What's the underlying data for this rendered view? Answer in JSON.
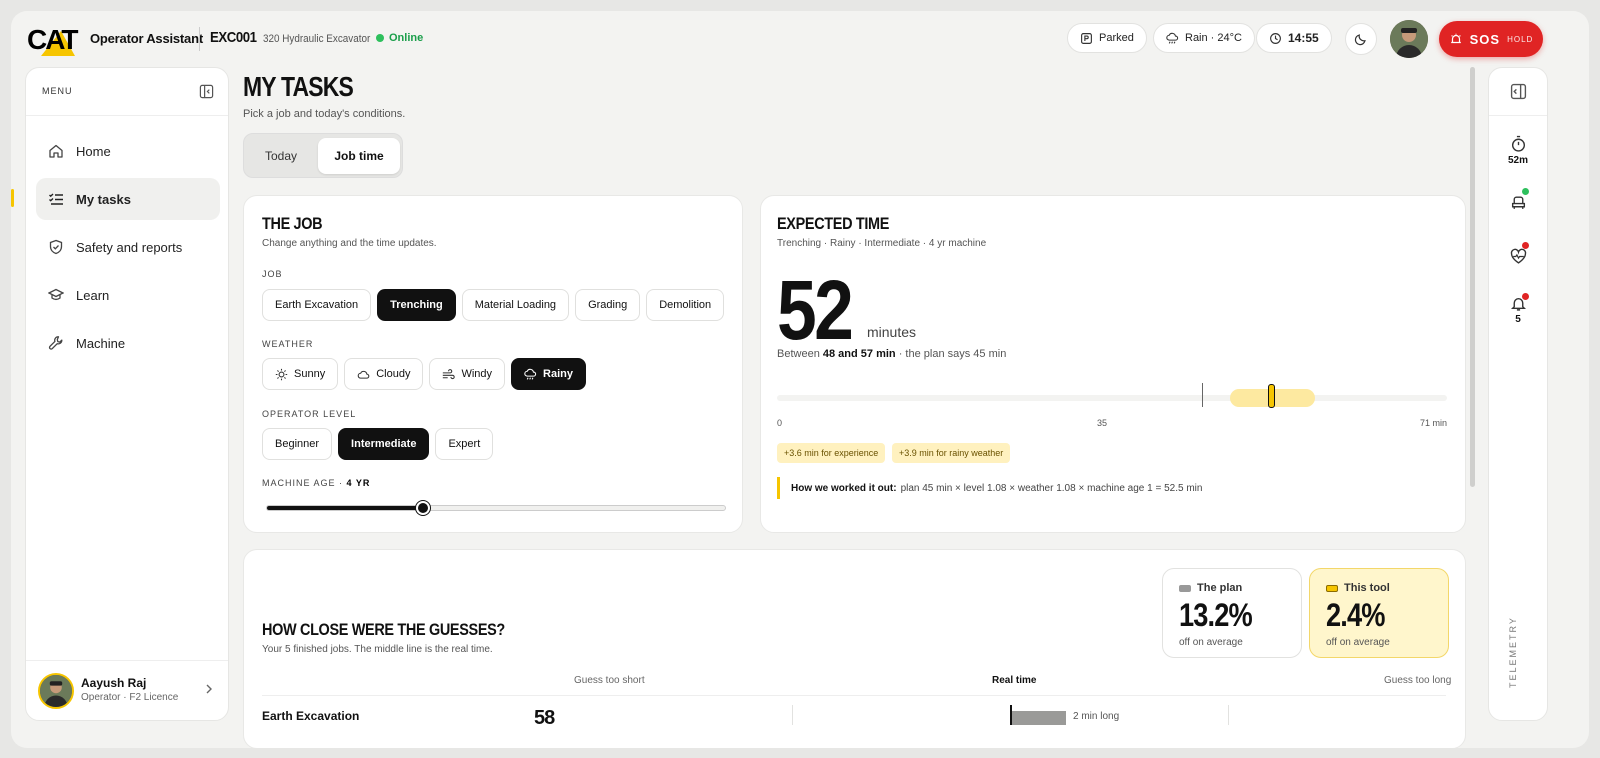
{
  "header": {
    "app_name": "Operator Assistant",
    "machine_id": "EXC001",
    "machine_model": "320 Hydraulic Excavator",
    "status": "Online",
    "parked": "Parked",
    "weather": "Rain · 24°C",
    "time": "14:55",
    "sos_label": "SOS",
    "sos_sub": "HOLD"
  },
  "sidebar": {
    "menu_label": "MENU",
    "items": [
      {
        "label": "Home",
        "icon": "home-icon"
      },
      {
        "label": "My tasks",
        "icon": "checklist-icon",
        "active": true
      },
      {
        "label": "Safety and reports",
        "icon": "shield-icon"
      },
      {
        "label": "Learn",
        "icon": "graduation-cap-icon"
      },
      {
        "label": "Machine",
        "icon": "wrench-icon"
      }
    ],
    "user": {
      "name": "Aayush Raj",
      "role": "Operator · F2 Licence"
    }
  },
  "page": {
    "title": "MY TASKS",
    "subtitle": "Pick a job and today's conditions.",
    "tabs": [
      "Today",
      "Job time"
    ],
    "active_tab": "Job time"
  },
  "job_card": {
    "title": "THE JOB",
    "subtitle": "Change anything and the time updates.",
    "job_label": "JOB",
    "jobs": [
      "Earth Excavation",
      "Trenching",
      "Material Loading",
      "Grading",
      "Demolition"
    ],
    "selected_job": "Trenching",
    "weather_label": "WEATHER",
    "weathers": [
      "Sunny",
      "Cloudy",
      "Windy",
      "Rainy"
    ],
    "selected_weather": "Rainy",
    "level_label": "OPERATOR LEVEL",
    "levels": [
      "Beginner",
      "Intermediate",
      "Expert"
    ],
    "selected_level": "Intermediate",
    "age_label": "MACHINE AGE · ",
    "age_value": "4 YR",
    "age_fraction": 0.34
  },
  "expected": {
    "title": "EXPECTED TIME",
    "subtitle": "Trenching · Rainy · Intermediate · 4 yr machine",
    "value": "52",
    "unit": "minutes",
    "between_prefix": "Between ",
    "between_range": "48 and 57 min",
    "between_suffix": " · the plan says 45 min",
    "scale_min": 0,
    "scale_max": 71,
    "plan": 45,
    "estimate": 52.5,
    "range_low": 48,
    "range_high": 57,
    "tick_labels": [
      "0",
      "35",
      "71 min"
    ],
    "tags": [
      "+3.6 min for experience",
      "+3.9 min for rainy weather"
    ],
    "how_label": "How we worked it out:",
    "how_text": "plan 45 min × level 1.08 × weather 1.08 × machine age 1 = 52.5 min"
  },
  "guesses": {
    "title": "HOW CLOSE WERE THE GUESSES?",
    "subtitle": "Your 5 finished jobs. The middle line is the real time.",
    "plan": {
      "label": "The plan",
      "value": "13.2%",
      "foot": "off on average"
    },
    "tool": {
      "label": "This tool",
      "value": "2.4%",
      "foot": "off on average"
    },
    "col_short": "Guess too short",
    "col_real": "Real time",
    "col_long": "Guess too long",
    "rows": [
      {
        "name": "Earth Excavation",
        "time": "58",
        "diff": "2 min long"
      }
    ]
  },
  "rail": {
    "timer": "52m",
    "alerts": "5",
    "label": "TELEMETRY"
  },
  "colors": {
    "accent": "#f6c500",
    "danger": "#e02424",
    "online": "#2ec05d"
  }
}
